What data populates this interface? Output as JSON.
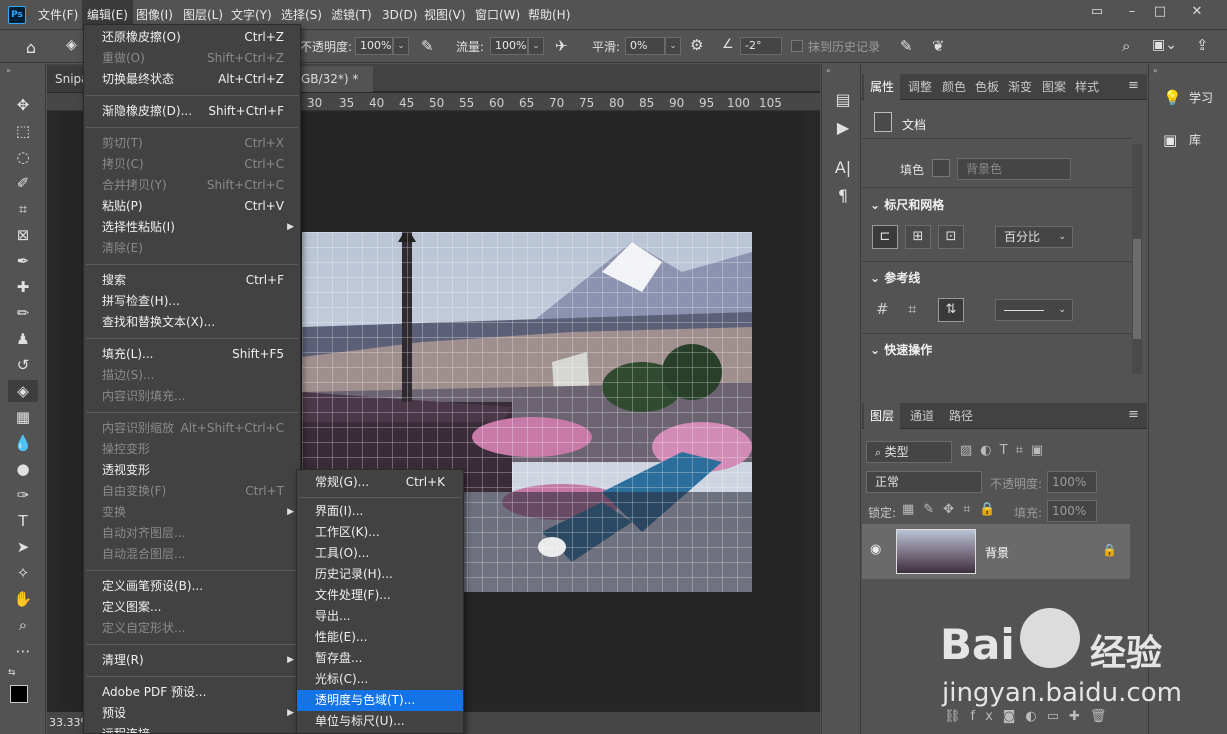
{
  "app": {
    "logo": "Ps"
  },
  "menubar": {
    "items": [
      "文件(F)",
      "编辑(E)",
      "图像(I)",
      "图层(L)",
      "文字(Y)",
      "选择(S)",
      "滤镜(T)",
      "3D(D)",
      "视图(V)",
      "窗口(W)",
      "帮助(H)"
    ],
    "window_buttons": [
      "▭",
      "–",
      "□",
      "✕"
    ]
  },
  "options": {
    "opacity_label": "不透明度:",
    "opacity_value": "100%",
    "flow_label": "流量:",
    "flow_value": "100%",
    "smooth_label": "平滑:",
    "smooth_value": "0%",
    "angle_value": "-2°",
    "erase_history_label": "抹到历史记录"
  },
  "document": {
    "tab_left": "Snipa",
    "tab_title": "GB/32*) *",
    "tab_close": "×",
    "zoom": "33.33%",
    "ruler_ticks": [
      "30",
      "35",
      "40",
      "45",
      "50",
      "55",
      "60",
      "65",
      "70",
      "75",
      "80",
      "85",
      "90",
      "95",
      "100",
      "105"
    ]
  },
  "edit_menu": {
    "items": [
      {
        "label": "还原橡皮擦(O)",
        "shortcut": "Ctrl+Z",
        "disabled": false
      },
      {
        "label": "重做(O)",
        "shortcut": "Shift+Ctrl+Z",
        "disabled": true
      },
      {
        "label": "切换最终状态",
        "shortcut": "Alt+Ctrl+Z",
        "disabled": false
      },
      {
        "label": "渐隐橡皮擦(D)...",
        "shortcut": "Shift+Ctrl+F",
        "disabled": false
      },
      {
        "label": "剪切(T)",
        "shortcut": "Ctrl+X",
        "disabled": true
      },
      {
        "label": "拷贝(C)",
        "shortcut": "Ctrl+C",
        "disabled": true
      },
      {
        "label": "合并拷贝(Y)",
        "shortcut": "Shift+Ctrl+C",
        "disabled": true
      },
      {
        "label": "粘贴(P)",
        "shortcut": "Ctrl+V",
        "disabled": false
      },
      {
        "label": "选择性粘贴(I)",
        "shortcut": "",
        "disabled": false,
        "submenu": true
      },
      {
        "label": "清除(E)",
        "shortcut": "",
        "disabled": true
      },
      {
        "label": "搜索",
        "shortcut": "Ctrl+F",
        "disabled": false
      },
      {
        "label": "拼写检查(H)...",
        "shortcut": "",
        "disabled": false
      },
      {
        "label": "查找和替换文本(X)...",
        "shortcut": "",
        "disabled": false
      },
      {
        "label": "填充(L)...",
        "shortcut": "Shift+F5",
        "disabled": false
      },
      {
        "label": "描边(S)...",
        "shortcut": "",
        "disabled": true
      },
      {
        "label": "内容识别填充...",
        "shortcut": "",
        "disabled": true
      },
      {
        "label": "内容识别缩放",
        "shortcut": "Alt+Shift+Ctrl+C",
        "disabled": true
      },
      {
        "label": "操控变形",
        "shortcut": "",
        "disabled": true
      },
      {
        "label": "透视变形",
        "shortcut": "",
        "disabled": false
      },
      {
        "label": "自由变换(F)",
        "shortcut": "Ctrl+T",
        "disabled": true
      },
      {
        "label": "变换",
        "shortcut": "",
        "disabled": true,
        "submenu": true
      },
      {
        "label": "自动对齐图层...",
        "shortcut": "",
        "disabled": true
      },
      {
        "label": "自动混合图层...",
        "shortcut": "",
        "disabled": true
      },
      {
        "label": "定义画笔预设(B)...",
        "shortcut": "",
        "disabled": false
      },
      {
        "label": "定义图案...",
        "shortcut": "",
        "disabled": false
      },
      {
        "label": "定义自定形状...",
        "shortcut": "",
        "disabled": true
      },
      {
        "label": "清理(R)",
        "shortcut": "",
        "disabled": false,
        "submenu": true
      },
      {
        "label": "Adobe PDF 预设...",
        "shortcut": "",
        "disabled": false
      },
      {
        "label": "预设",
        "shortcut": "",
        "disabled": false,
        "submenu": true
      },
      {
        "label": "远程连接...",
        "shortcut": "",
        "disabled": false
      }
    ]
  },
  "prefs_submenu": {
    "items": [
      {
        "label": "常规(G)...",
        "shortcut": "Ctrl+K"
      },
      {
        "label": "界面(I)...",
        "shortcut": ""
      },
      {
        "label": "工作区(K)...",
        "shortcut": ""
      },
      {
        "label": "工具(O)...",
        "shortcut": ""
      },
      {
        "label": "历史记录(H)...",
        "shortcut": ""
      },
      {
        "label": "文件处理(F)...",
        "shortcut": ""
      },
      {
        "label": "导出...",
        "shortcut": ""
      },
      {
        "label": "性能(E)...",
        "shortcut": ""
      },
      {
        "label": "暂存盘...",
        "shortcut": ""
      },
      {
        "label": "光标(C)...",
        "shortcut": ""
      },
      {
        "label": "透明度与色域(T)...",
        "shortcut": ""
      },
      {
        "label": "单位与标尺(U)...",
        "shortcut": ""
      }
    ],
    "highlighted_index": 10
  },
  "properties": {
    "tabs": [
      "属性",
      "调整",
      "颜色",
      "色板",
      "渐变",
      "图案",
      "样式"
    ],
    "doc_label": "文档",
    "fill_label": "填色",
    "fill_value": "背景色",
    "rulers_grid": "标尺和网格",
    "unit_value": "百分比",
    "guides": "参考线",
    "quick_actions": "快速操作"
  },
  "layers": {
    "tabs": [
      "图层",
      "通道",
      "路径"
    ],
    "filter_label": "类型",
    "blend_mode": "正常",
    "opacity_label": "不透明度:",
    "opacity_value": "100%",
    "lock_label": "锁定:",
    "fill_label": "填充:",
    "fill_value": "100%",
    "layer_name": "背景"
  },
  "right_panel": {
    "learn": "学习",
    "library": "库"
  },
  "watermark": {
    "text1": "Bai",
    "text2": "经验",
    "url": "jingyan.baidu.com"
  }
}
